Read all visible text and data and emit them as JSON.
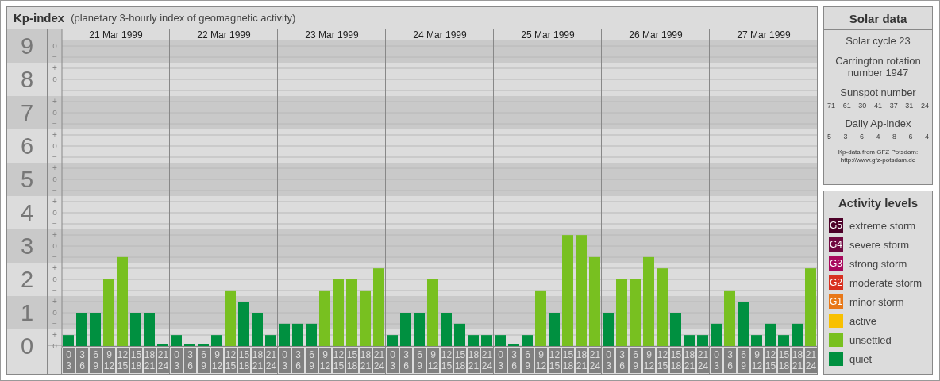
{
  "header": {
    "title": "Kp-index",
    "subtitle": "(planetary 3-hourly index of geomagnetic activity)"
  },
  "chart": {
    "y_marks": [
      "o",
      "−",
      "+",
      "o",
      "−",
      "+",
      "o",
      "−",
      "+",
      "o",
      "−",
      "+",
      "o",
      "−",
      "+",
      "o",
      "−",
      "+",
      "o",
      "−",
      "+",
      "o",
      "−",
      "+",
      "o",
      "−",
      "+",
      "o"
    ],
    "days": [
      {
        "date": "21 Mar 1999",
        "slots": [
          {
            "from": "0",
            "to": "3"
          },
          {
            "from": "3",
            "to": "6"
          },
          {
            "from": "6",
            "to": "9"
          },
          {
            "from": "9",
            "to": "12"
          },
          {
            "from": "12",
            "to": "15"
          },
          {
            "from": "15",
            "to": "18"
          },
          {
            "from": "18",
            "to": "21"
          },
          {
            "from": "21",
            "to": "24"
          }
        ]
      },
      {
        "date": "22 Mar 1999",
        "slots": [
          {
            "from": "0",
            "to": "3"
          },
          {
            "from": "3",
            "to": "6"
          },
          {
            "from": "6",
            "to": "9"
          },
          {
            "from": "9",
            "to": "12"
          },
          {
            "from": "12",
            "to": "15"
          },
          {
            "from": "15",
            "to": "18"
          },
          {
            "from": "18",
            "to": "21"
          },
          {
            "from": "21",
            "to": "24"
          }
        ]
      },
      {
        "date": "23 Mar 1999",
        "slots": [
          {
            "from": "0",
            "to": "3"
          },
          {
            "from": "3",
            "to": "6"
          },
          {
            "from": "6",
            "to": "9"
          },
          {
            "from": "9",
            "to": "12"
          },
          {
            "from": "12",
            "to": "15"
          },
          {
            "from": "15",
            "to": "18"
          },
          {
            "from": "18",
            "to": "21"
          },
          {
            "from": "21",
            "to": "24"
          }
        ]
      },
      {
        "date": "24 Mar 1999",
        "slots": [
          {
            "from": "0",
            "to": "3"
          },
          {
            "from": "3",
            "to": "6"
          },
          {
            "from": "6",
            "to": "9"
          },
          {
            "from": "9",
            "to": "12"
          },
          {
            "from": "12",
            "to": "15"
          },
          {
            "from": "15",
            "to": "18"
          },
          {
            "from": "18",
            "to": "21"
          },
          {
            "from": "21",
            "to": "24"
          }
        ]
      },
      {
        "date": "25 Mar 1999",
        "slots": [
          {
            "from": "0",
            "to": "3"
          },
          {
            "from": "3",
            "to": "6"
          },
          {
            "from": "6",
            "to": "9"
          },
          {
            "from": "9",
            "to": "12"
          },
          {
            "from": "12",
            "to": "15"
          },
          {
            "from": "15",
            "to": "18"
          },
          {
            "from": "18",
            "to": "21"
          },
          {
            "from": "21",
            "to": "24"
          }
        ]
      },
      {
        "date": "26 Mar 1999",
        "slots": [
          {
            "from": "0",
            "to": "3"
          },
          {
            "from": "3",
            "to": "6"
          },
          {
            "from": "6",
            "to": "9"
          },
          {
            "from": "9",
            "to": "12"
          },
          {
            "from": "12",
            "to": "15"
          },
          {
            "from": "15",
            "to": "18"
          },
          {
            "from": "18",
            "to": "21"
          },
          {
            "from": "21",
            "to": "24"
          }
        ]
      },
      {
        "date": "27 Mar 1999",
        "slots": [
          {
            "from": "0",
            "to": "3"
          },
          {
            "from": "3",
            "to": "6"
          },
          {
            "from": "6",
            "to": "9"
          },
          {
            "from": "9",
            "to": "12"
          },
          {
            "from": "12",
            "to": "15"
          },
          {
            "from": "15",
            "to": "18"
          },
          {
            "from": "18",
            "to": "21"
          },
          {
            "from": "21",
            "to": "24"
          }
        ]
      }
    ],
    "chart_data": {
      "type": "bar",
      "grid": true,
      "ylim": [
        0,
        9.5
      ],
      "yticks": [
        0,
        1,
        2,
        3,
        4,
        5,
        6,
        7,
        8,
        9
      ],
      "values": [
        0.33,
        1,
        1,
        2,
        2.67,
        1,
        1,
        0,
        0.33,
        0,
        0,
        0.33,
        1.67,
        1.33,
        1,
        0.33,
        0.67,
        0.67,
        0.67,
        1.67,
        2,
        2,
        1.67,
        2.33,
        0.33,
        1,
        1,
        2,
        1,
        0.67,
        0.33,
        0.33,
        0.33,
        0,
        0.33,
        1.67,
        1,
        3.33,
        3.33,
        2.67,
        1,
        2,
        2,
        2.67,
        2.33,
        1,
        0.33,
        0.33,
        0.67,
        1.67,
        1.33,
        0.33,
        0.67,
        0.33,
        0.67,
        2.33
      ]
    }
  },
  "solar_data": {
    "title": "Solar data",
    "cycle": "Solar cycle 23",
    "rotation": "Carrington rotation number 1947",
    "sunspot_label": "Sunspot number",
    "sunspots": [
      "71",
      "61",
      "30",
      "41",
      "37",
      "31",
      "24"
    ],
    "ap_label": "Daily Ap-index",
    "ap": [
      "5",
      "3",
      "6",
      "4",
      "8",
      "6",
      "4"
    ],
    "source": "Kp-data from GFZ Potsdam:",
    "url": "http://www.gfz-potsdam.de"
  },
  "legend": {
    "title": "Activity levels",
    "items": [
      {
        "code": "G5",
        "label": "extreme storm",
        "color": "#4c0028"
      },
      {
        "code": "G4",
        "label": "severe storm",
        "color": "#700840"
      },
      {
        "code": "G3",
        "label": "strong storm",
        "color": "#a8085c"
      },
      {
        "code": "G2",
        "label": "moderate storm",
        "color": "#d83020"
      },
      {
        "code": "G1",
        "label": "minor storm",
        "color": "#e87818"
      },
      {
        "label": "active",
        "color": "#f8c000"
      },
      {
        "label": "unsettled",
        "color": "#78c020"
      },
      {
        "label": "quiet",
        "color": "#009040"
      }
    ]
  }
}
